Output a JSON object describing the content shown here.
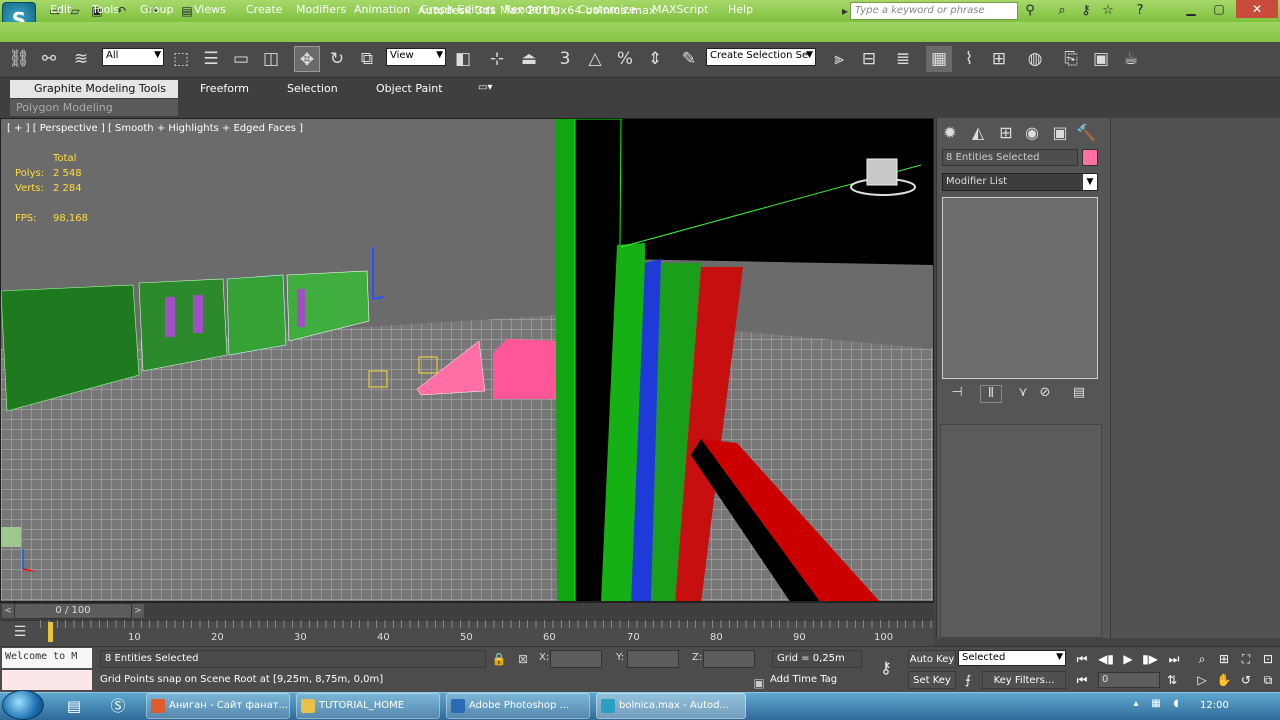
{
  "window": {
    "title": "Autodesk 3ds Max  2011 x64      bolnica.max",
    "search_placeholder": "Type a keyword or phrase"
  },
  "menu": [
    "Edit",
    "Tools",
    "Group",
    "Views",
    "Create",
    "Modifiers",
    "Animation",
    "Graph Editors",
    "Rendering",
    "Customize",
    "MAXScript",
    "Help"
  ],
  "toolbar": {
    "selection_filter": "All",
    "ref_coord": "View",
    "named_selection": "Create Selection Se"
  },
  "ribbon": {
    "tabs": [
      "Graphite Modeling Tools",
      "Freeform",
      "Selection",
      "Object Paint"
    ],
    "subtab": "Polygon Modeling"
  },
  "viewport": {
    "label": "[ + ] [ Perspective ] [ Smooth + Highlights + Edged Faces ]",
    "stats": {
      "header": "Total",
      "polys_label": "Polys:",
      "polys": "2 548",
      "verts_label": "Verts:",
      "verts": "2 284",
      "fps_label": "FPS:",
      "fps": "98,168"
    }
  },
  "command_panel": {
    "selection_name": "8 Entities Selected",
    "selection_color": "#ff6fa6",
    "modifier_list": "Modifier List"
  },
  "time_slider": {
    "frame": "0 / 100",
    "ticks": [
      "10",
      "20",
      "30",
      "40",
      "50",
      "60",
      "70",
      "80",
      "90",
      "100"
    ]
  },
  "status": {
    "maxscript": "Welcome to M",
    "selection": "8 Entities Selected",
    "prompt": "Grid Points snap on Scene Root at [9,25m, 8,75m, 0,0m]",
    "x_label": "X:",
    "y_label": "Y:",
    "z_label": "Z:",
    "grid": "Grid = 0,25m",
    "add_time_tag": "Add Time Tag",
    "auto_key": "Auto Key",
    "set_key": "Set Key",
    "key_mode": "Selected",
    "key_filters": "Key Filters...",
    "current_frame": "0"
  },
  "taskbar": {
    "items": [
      {
        "label": "Аниган - Сайт фанат...",
        "color": "#e05b2b"
      },
      {
        "label": "TUTORIAL_HOME",
        "color": "#e8c04a"
      },
      {
        "label": "Adobe Photoshop ...",
        "color": "#2b6bb5"
      },
      {
        "label": "bolnica.max - Autod...",
        "color": "#2a9fc0"
      }
    ],
    "clock": "12:00"
  }
}
